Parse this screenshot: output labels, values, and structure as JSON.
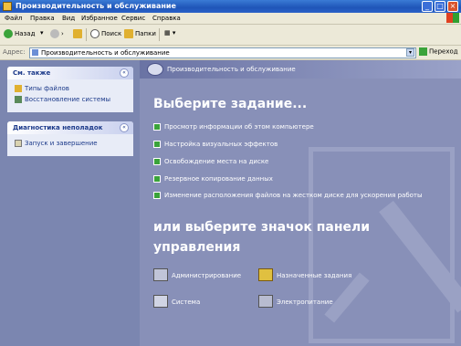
{
  "window": {
    "title": "Производительность и обслуживание",
    "minimize_icon": "_",
    "maximize_icon": "□",
    "close_icon": "×"
  },
  "menu": [
    "Файл",
    "Правка",
    "Вид",
    "Избранное",
    "Сервис",
    "Справка"
  ],
  "toolbar": {
    "back_label": "Назад",
    "back_dropdown": "▾",
    "forward_icon": "›",
    "up_icon": "▲",
    "search_label": "Поиск",
    "folders_label": "Папки",
    "views_label": "▦ ▾"
  },
  "address": {
    "label": "Адрес:",
    "value": "Производительность и обслуживание",
    "dropdown_icon": "▾",
    "go_label": "Переход"
  },
  "sidebar": {
    "see_also": {
      "title": "См. также",
      "chevron": "«",
      "items": [
        "Типы файлов",
        "Восстановление системы"
      ]
    },
    "troubleshoot": {
      "title": "Диагностика неполадок",
      "chevron": "«",
      "items": [
        "Запуск и завершение"
      ]
    }
  },
  "main": {
    "breadcrumb": "Производительность и обслуживание",
    "heading": "Выберите задание...",
    "tasks": [
      "Просмотр информации об этом компьютере",
      "Настройка визуальных эффектов",
      "Освобождение места на диске",
      "Резервное копирование данных",
      "Изменение расположения файлов на жестком диске для ускорения работы"
    ],
    "heading2_line1": "или выберите значок панели",
    "heading2_line2": "управления",
    "control_panel_items": [
      "Администрирование",
      "Назначенные задания",
      "Система",
      "Электропитание"
    ]
  },
  "colors": {
    "titlebar": "#1f55b8",
    "sidebar_bg": "#7b86b0",
    "main_bg": "#8890b8",
    "task_arrow": "#3aa33a"
  }
}
